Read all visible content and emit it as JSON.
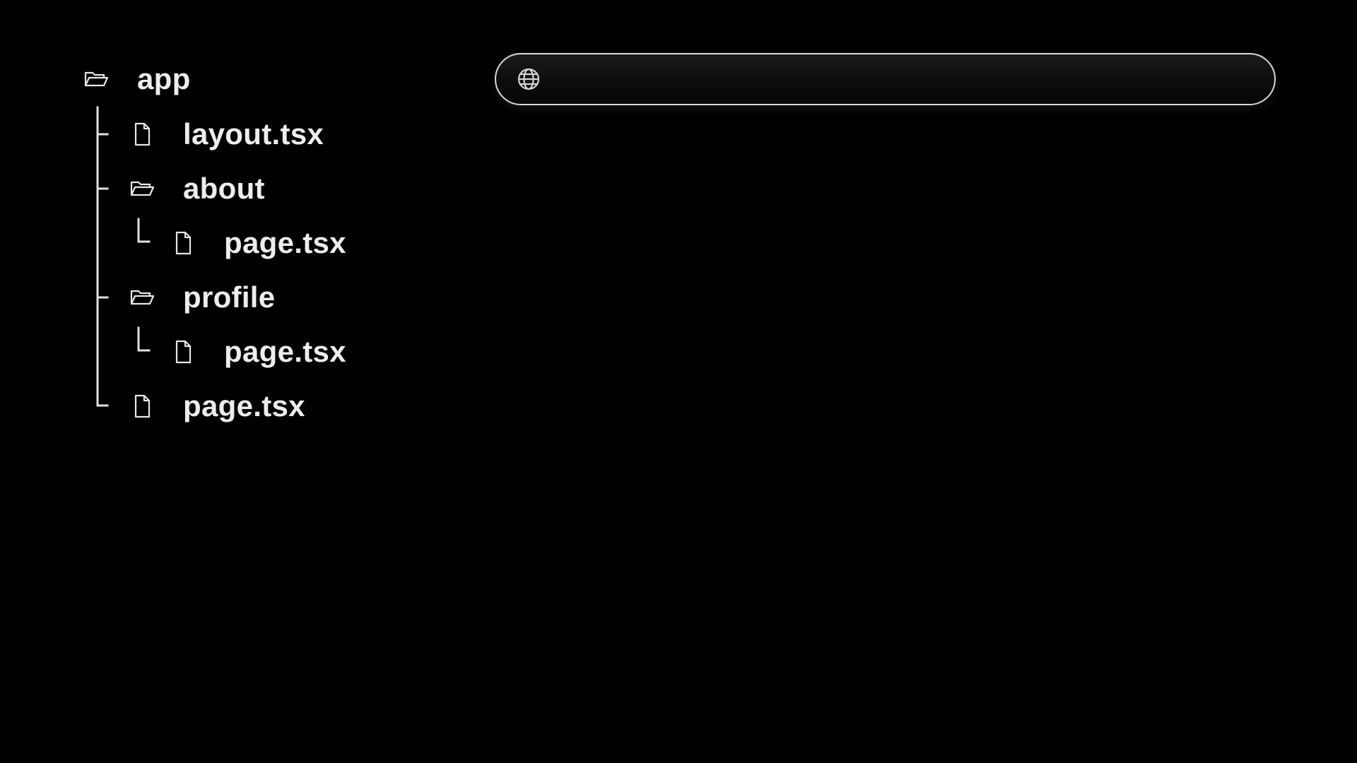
{
  "file_tree": {
    "root": {
      "label": "app",
      "icon": "folder-open-icon"
    },
    "items": [
      {
        "label": "layout.tsx",
        "icon": "file-icon"
      },
      {
        "label": "about",
        "icon": "folder-open-icon"
      },
      {
        "label": "page.tsx",
        "icon": "file-icon"
      },
      {
        "label": "profile",
        "icon": "folder-open-icon"
      },
      {
        "label": "page.tsx",
        "icon": "file-icon"
      },
      {
        "label": "page.tsx",
        "icon": "file-icon"
      }
    ]
  },
  "address_bar": {
    "icon": "globe-icon",
    "value": "",
    "placeholder": ""
  },
  "colors": {
    "background": "#000000",
    "text": "#ededed",
    "bar_border": "#d8d8d8"
  }
}
